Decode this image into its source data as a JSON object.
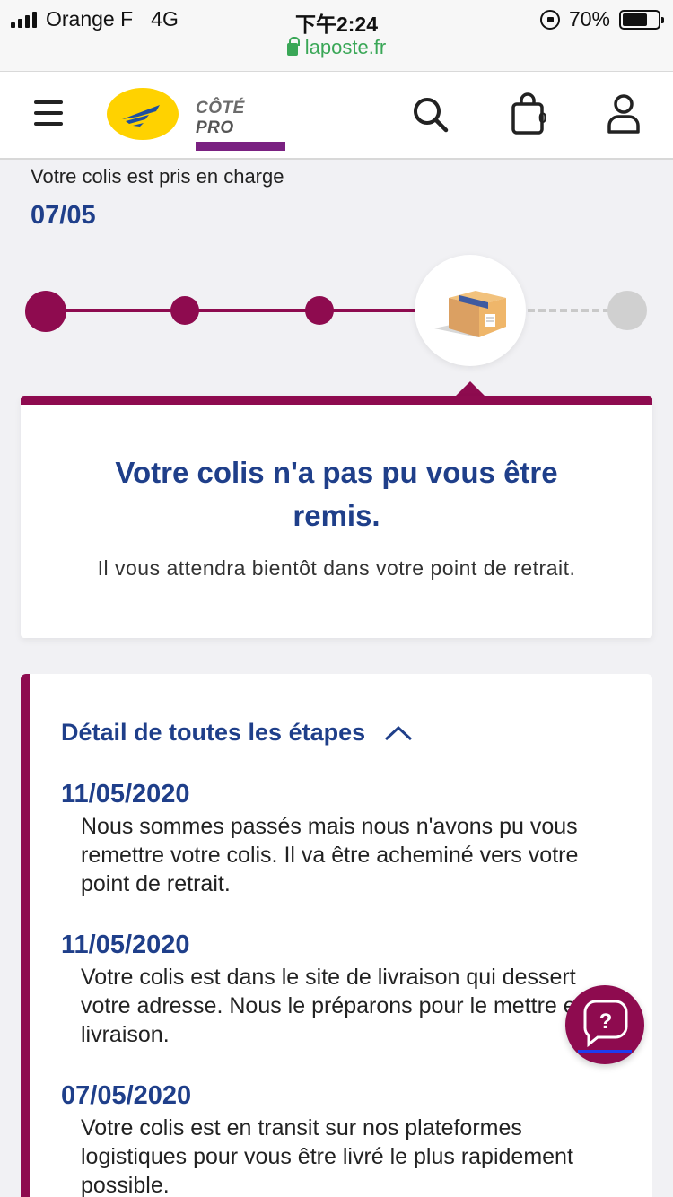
{
  "status_bar": {
    "carrier": "Orange F",
    "network": "4G",
    "time": "下午2:24",
    "battery_percent": "70%",
    "battery_level": 0.7,
    "url": "laposte.fr"
  },
  "header": {
    "brand_prefix": "CÔTÉ",
    "brand_suffix": "PRO",
    "cart_count": "0",
    "icons": [
      "menu-icon",
      "laposte-logo",
      "search-icon",
      "cart-icon",
      "account-icon"
    ]
  },
  "tracking": {
    "status_text": "Votre colis est pris en charge",
    "status_date": "07/05",
    "steps_total": 5,
    "current_step": 4
  },
  "message": {
    "title": "Votre colis n'a pas pu vous être remis.",
    "subtitle": "Il vous attendra bientôt dans votre point de retrait."
  },
  "details": {
    "title": "Détail de toutes les étapes",
    "events": [
      {
        "date": "11/05/2020",
        "text": "Nous sommes passés mais nous n'avons pu vous remettre votre colis. Il va être acheminé vers votre point de retrait."
      },
      {
        "date": "11/05/2020",
        "text": "Votre colis est dans le site de livraison qui dessert votre adresse. Nous le préparons pour le mettre en livraison."
      },
      {
        "date": "07/05/2020",
        "text": "Votre colis est en transit sur nos plateformes logistiques pour vous être livré le plus rapidement possible."
      }
    ]
  },
  "help_button": {
    "label": "?"
  },
  "colors": {
    "brand": "#8e0b4f",
    "title": "#1f3f8a",
    "url": "#3aa757"
  }
}
